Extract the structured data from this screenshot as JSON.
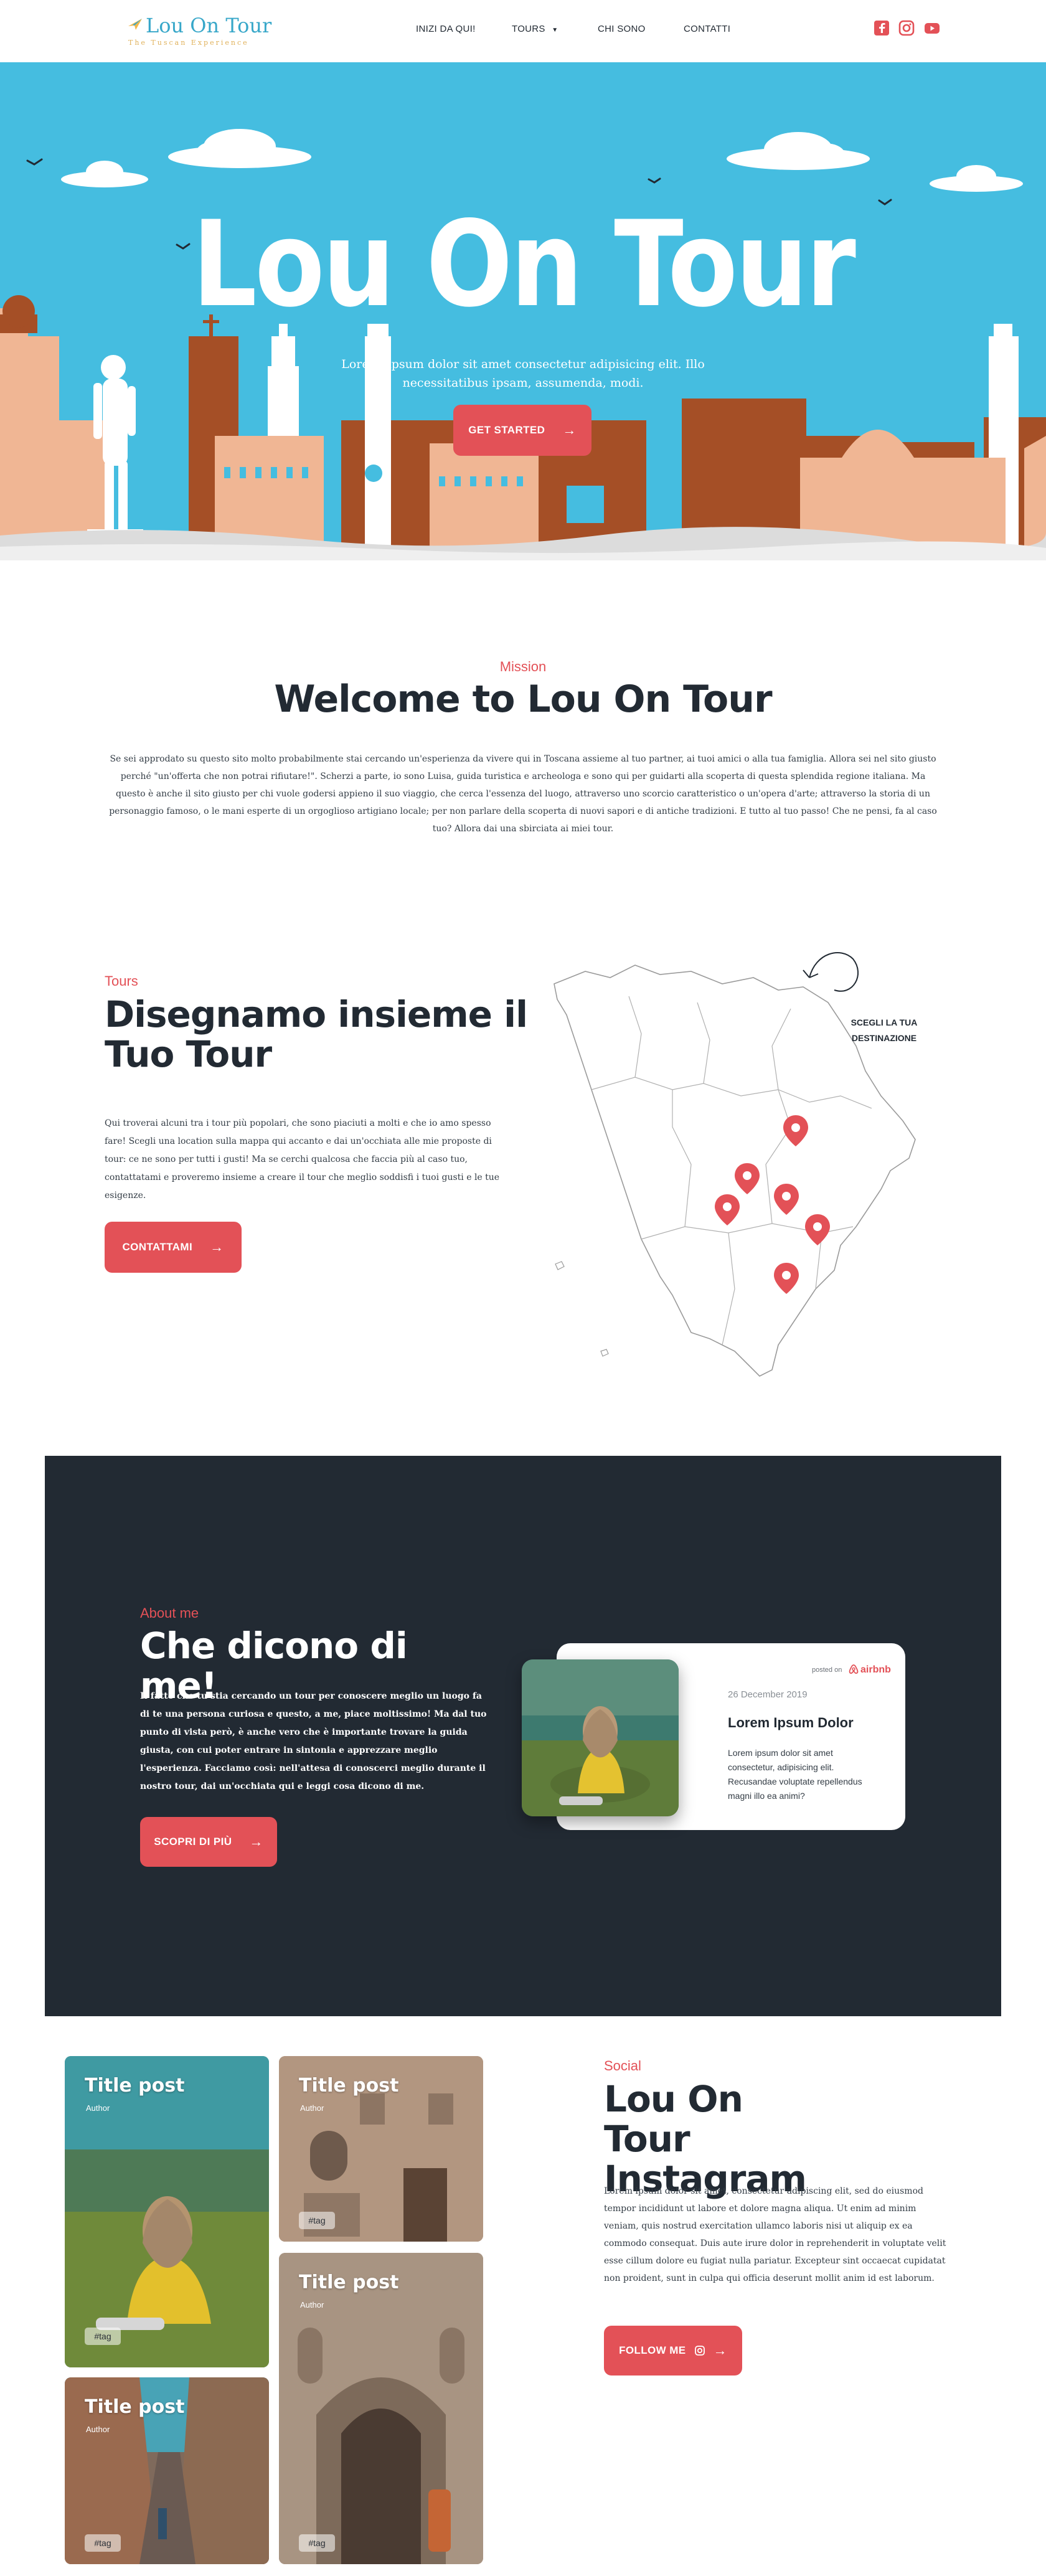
{
  "header": {
    "logo_text": "Lou On Tour",
    "logo_tagline": "The Tuscan Experience",
    "nav": [
      {
        "label": "INIZI DA QUI!"
      },
      {
        "label": "TOURS"
      },
      {
        "label": "CHI SONO"
      },
      {
        "label": "CONTATTI"
      }
    ],
    "social_icons": [
      "facebook-icon",
      "instagram-icon",
      "youtube-icon"
    ],
    "brand_color": "#e35157"
  },
  "hero": {
    "title": "Lou On Tour",
    "subtitle": "Lorem, ipsum dolor sit amet consectetur adipisicing elit. Illo necessitatibus ipsam, assumenda, modi.",
    "cta_label": "GET STARTED",
    "sky_color": "#45bde0",
    "skyline_color": "#a54f26"
  },
  "mission": {
    "eyebrow": "Mission",
    "title": "Welcome to Lou On Tour",
    "body": "Se sei approdato su questo sito molto probabilmente stai cercando un'esperienza da vivere qui in Toscana assieme al tuo partner, ai tuoi amici o alla tua famiglia. Allora sei nel sito giusto perché \"un'offerta che non potrai rifiutare!\". Scherzi a parte, io sono Luisa, guida turistica e archeologa e sono qui per guidarti alla scoperta di questa splendida regione italiana. Ma questo è anche il sito giusto per chi vuole godersi appieno il suo viaggio, che cerca l'essenza del luogo, attraverso uno scorcio caratteristico o un'opera d'arte; attraverso la storia di un personaggio famoso, o le mani esperte di un orgoglioso artigiano locale; per non parlare della scoperta di nuovi sapori e di antiche tradizioni. E tutto al tuo passo! Che ne pensi, fa al caso tuo? Allora dai una sbirciata ai miei tour."
  },
  "tours": {
    "eyebrow": "Tours",
    "title": "Disegnamo insieme il Tuo Tour",
    "body": "Qui troverai alcuni tra i tour più popolari, che sono piaciuti a molti e che io amo spesso fare! Scegli una location sulla mappa qui accanto e dai un'occhiata alle mie proposte di tour: ce ne sono per tutti i gusti! Ma se cerchi qualcosa che faccia più al caso tuo, contattatami e proveremo insieme a creare il tour che meglio soddisfi i tuoi gusti e le tue esigenze.",
    "cta_label": "CONTATTAMI",
    "map_hint": "SCEGLI LA TUA DESTINAZIONE",
    "pin_color": "#e35157"
  },
  "about": {
    "eyebrow": "About me",
    "title": "Che dicono di me!",
    "body": "Il fatto che tu stia cercando un tour per conoscere meglio un luogo fa di te una persona curiosa e questo, a me, piace moltissimo! Ma dal tuo punto di vista però, è anche vero che è importante trovare la guida giusta, con cui poter entrare in sintonia e apprezzare meglio l'esperienza. Facciamo così: nell'attesa di conoscerci meglio durante il nostro tour, dai un'occhiata qui e leggi cosa dicono di me.",
    "cta_label": "SCOPRI DI PIÙ",
    "review": {
      "posted_on": "posted on",
      "platform": "airbnb",
      "date": "26 December 2019",
      "title": "Lorem Ipsum Dolor",
      "text": "Lorem ipsum dolor sit amet consectetur, adipisicing elit. Recusandae voluptate repellendus magni illo ea animi?"
    },
    "bg_color": "#222a33"
  },
  "instagram": {
    "eyebrow": "Social",
    "title": "Lou On Tour Instagram",
    "body": "Lorem ipsum dolor sit amet, consectetur adipiscing elit, sed do eiusmod tempor incididunt ut labore et dolore magna aliqua. Ut enim ad minim veniam, quis nostrud exercitation ullamco laboris nisi ut aliquip ex ea commodo consequat. Duis aute irure dolor in reprehenderit in voluptate velit esse cillum dolore eu fugiat nulla pariatur. Excepteur sint occaecat cupidatat non proident, sunt in culpa qui officia deserunt mollit anim id est laborum.",
    "cta_label": "FOLLOW ME",
    "posts": [
      {
        "title": "Title post",
        "author": "Author",
        "tag": "#tag"
      },
      {
        "title": "Title post",
        "author": "Author",
        "tag": "#tag"
      },
      {
        "title": "Title post",
        "author": "Author",
        "tag": "#tag"
      },
      {
        "title": "Title post",
        "author": "Author",
        "tag": "#tag"
      }
    ]
  }
}
